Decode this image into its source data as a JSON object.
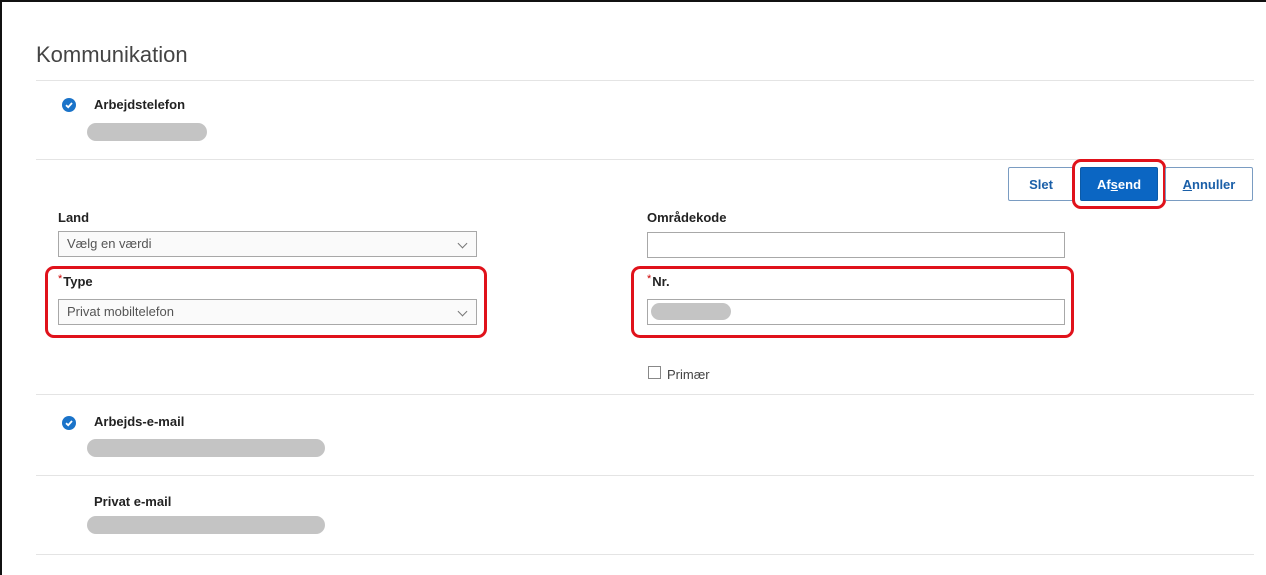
{
  "section": {
    "title": "Kommunikation"
  },
  "work_phone": {
    "label": "Arbejdstelefon"
  },
  "actions": {
    "delete": "Slet",
    "submit": {
      "pre": "Af",
      "key": "s",
      "post": "end"
    },
    "cancel": {
      "key": "A",
      "post": "nnuller"
    }
  },
  "form": {
    "country": {
      "label": "Land",
      "value": "Vælg en værdi"
    },
    "area_code": {
      "label": "Områdekode",
      "value": ""
    },
    "type": {
      "required_mark": "*",
      "label": "Type",
      "value": "Privat mobiltelefon"
    },
    "number": {
      "required_mark": "*",
      "label": "Nr."
    },
    "primary": {
      "label": "Primær",
      "checked": false
    }
  },
  "work_email": {
    "label": "Arbejds-e-mail"
  },
  "private_email": {
    "label": "Privat e-mail"
  },
  "colors": {
    "accent": "#0b66c3",
    "highlight": "#e0121b",
    "check": "#1a73c9"
  }
}
